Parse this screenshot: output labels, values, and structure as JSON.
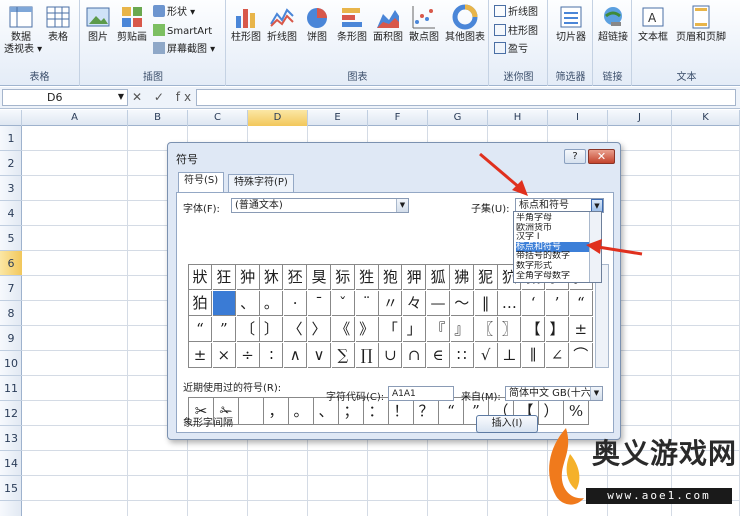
{
  "ribbon": {
    "groups": [
      {
        "label": "表格",
        "buttons": [
          "数据\n透视表 ▾",
          "表格"
        ]
      },
      {
        "label": "插图",
        "buttons": [
          "图片",
          "剪贴画"
        ],
        "small": [
          "形状 ▾",
          "SmartArt",
          "屏幕截图 ▾"
        ]
      },
      {
        "label": "图表",
        "buttons": [
          "柱形图",
          "折线图",
          "饼图",
          "条形图",
          "面积图",
          "散点图",
          "其他图表"
        ]
      },
      {
        "label": "迷你图",
        "small": [
          "折线图",
          "柱形图",
          "盈亏"
        ]
      },
      {
        "label": "筛选器",
        "buttons": [
          "切片器"
        ]
      },
      {
        "label": "链接",
        "buttons": [
          "超链接"
        ]
      },
      {
        "label": "文本",
        "buttons": [
          "文本框",
          "页眉和页脚"
        ]
      }
    ],
    "accent": "#e4ecf7"
  },
  "formula_bar": {
    "cell_ref": "D6",
    "fx_symbols": "✕ ✓ fx",
    "formula": ""
  },
  "sheet": {
    "columns": [
      "A",
      "B",
      "C",
      "D",
      "E",
      "F",
      "G",
      "H",
      "I",
      "J",
      "K"
    ],
    "rows": [
      "1",
      "2",
      "3",
      "4",
      "5",
      "6",
      "7",
      "8",
      "9",
      "10",
      "11",
      "12",
      "13",
      "14",
      "15"
    ],
    "active_col": "D",
    "active_row": "6"
  },
  "dialog": {
    "title": "符号",
    "help_label": "?",
    "close_label": "✕",
    "tabs": [
      "符号(S)",
      "特殊字符(P)"
    ],
    "font_label": "字体(F):",
    "font_value": "(普通文本)",
    "subset_label": "子集(U):",
    "subset_value": "标点和符号",
    "subset_options": [
      "半角字母",
      "欧洲货币",
      "汉字 I",
      "标点和符号",
      "带括号的数字",
      "数字形式",
      "全角字母数字"
    ],
    "subset_highlight_index": 3,
    "symbol_rows": [
      [
        "狀",
        "狂",
        "狆",
        "狇",
        "狉",
        "狊",
        "狋",
        "狌",
        "狍",
        "狎",
        "狐",
        "狒",
        "狔",
        "狖",
        "狘",
        "狙",
        "狚"
      ],
      [
        "狛",
        "",
        "、",
        "。",
        "·",
        "ˉ",
        "ˇ",
        "¨",
        "〃",
        "々",
        "—",
        "～",
        "‖",
        "…",
        "‘",
        "’",
        "“"
      ],
      [
        "“",
        "”",
        "〔",
        "〕",
        "〈",
        "〉",
        "《",
        "》",
        "「",
        "」",
        "『",
        "』",
        "〖",
        "〗",
        "【",
        "】",
        "±"
      ],
      [
        "±",
        "×",
        "÷",
        "∶",
        "∧",
        "∨",
        "∑",
        "∏",
        "∪",
        "∩",
        "∈",
        "∷",
        "√",
        "⊥",
        "∥",
        "∠",
        "⌒"
      ]
    ],
    "recent_label": "近期使用过的符号(R):",
    "recent_symbols": [
      "✂",
      "✁",
      "",
      "，",
      "。",
      "、",
      "；",
      "：",
      "！",
      "？",
      "“",
      "”",
      "（",
      "【",
      "）",
      "%"
    ],
    "char_name": "象形字间隔",
    "code_label": "字符代码(C):",
    "code_value": "A1A1",
    "from_label": "来自(M):",
    "from_value": "简体中文 GB(十六",
    "insert_label": "插入(I)"
  },
  "watermark": {
    "title": "奥义游戏网",
    "url": "www.aoe1.com"
  }
}
